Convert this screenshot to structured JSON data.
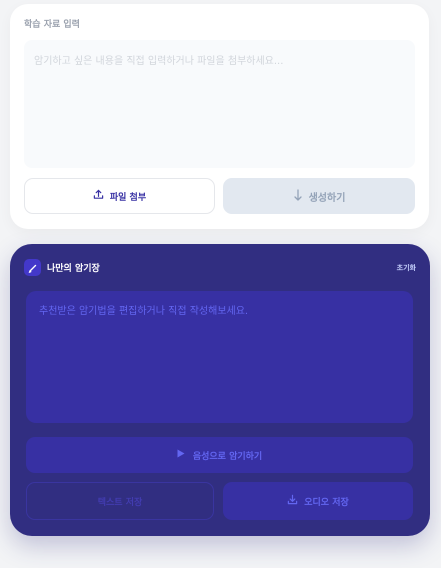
{
  "input_section": {
    "label": "학습 자료 입력",
    "placeholder": "암기하고 싶은 내용을 직접 입력하거나 파일을 첨부하세요...",
    "attach_label": "파일 첨부",
    "generate_label": "생성하기"
  },
  "notebook": {
    "title": "나만의 암기장",
    "reset_label": "초기화",
    "placeholder": "추천받은 암기법을 편집하거나 직접 작성해보세요.",
    "voice_label": "음성으로 암기하기",
    "left_button_label": "텍스트 저장",
    "audio_label": "오디오 저장"
  },
  "icons": {
    "attach": "upload-icon",
    "generate": "arrow-down-icon",
    "title": "pencil-icon",
    "voice": "play-icon",
    "audio": "download-icon"
  },
  "colors": {
    "page_bg": "#f3f4f6",
    "card_bg": "#ffffff",
    "notebook_bg": "#312e81",
    "accent": "#3730a3",
    "muted_accent": "#6366f1"
  }
}
